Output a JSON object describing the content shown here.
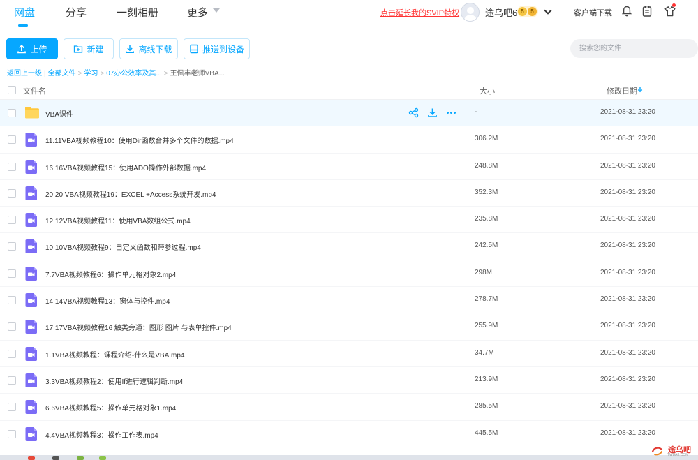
{
  "nav": {
    "tabs": [
      {
        "label": "网盘",
        "active": true
      },
      {
        "label": "分享",
        "active": false
      },
      {
        "label": "一刻相册",
        "active": false
      },
      {
        "label": "更多",
        "active": false
      }
    ],
    "svip_promo": "点击延长我的SVIP特权",
    "username": "途乌吧6",
    "badges": [
      "5",
      "5"
    ],
    "client_download": "客户端下载",
    "icons": [
      "bell-icon",
      "clipboard-icon",
      "shirt-icon"
    ]
  },
  "toolbar": {
    "upload": "上传",
    "new": "新建",
    "offline_download": "离线下载",
    "push_to_device": "推送到设备",
    "search_placeholder": "搜索您的文件"
  },
  "breadcrumb": {
    "back": "返回上一级",
    "all_files": "全部文件",
    "level1": "学习",
    "level2": "07办公效率及其...",
    "current": "王佩丰老师VBA..."
  },
  "table": {
    "headers": {
      "name": "文件名",
      "size": "大小",
      "modified": "修改日期"
    },
    "sort": "modified-desc",
    "rows": [
      {
        "type": "folder",
        "name": "VBA课件",
        "size": "-",
        "date": "2021-08-31 23:20"
      },
      {
        "type": "video",
        "name": "11.11VBA视频教程10：使用Dir函数合并多个文件的数据.mp4",
        "size": "306.2M",
        "date": "2021-08-31 23:20"
      },
      {
        "type": "video",
        "name": "16.16VBA视频教程15：使用ADO操作外部数据.mp4",
        "size": "248.8M",
        "date": "2021-08-31 23:20"
      },
      {
        "type": "video",
        "name": "20.20 VBA视频教程19：EXCEL +Access系统开发.mp4",
        "size": "352.3M",
        "date": "2021-08-31 23:20"
      },
      {
        "type": "video",
        "name": "12.12VBA视频教程11：使用VBA数组公式.mp4",
        "size": "235.8M",
        "date": "2021-08-31 23:20"
      },
      {
        "type": "video",
        "name": "10.10VBA视频教程9：自定义函数和带参过程.mp4",
        "size": "242.5M",
        "date": "2021-08-31 23:20"
      },
      {
        "type": "video",
        "name": "7.7VBA视频教程6：操作单元格对象2.mp4",
        "size": "298M",
        "date": "2021-08-31 23:20"
      },
      {
        "type": "video",
        "name": "14.14VBA视频教程13：窗体与控件.mp4",
        "size": "278.7M",
        "date": "2021-08-31 23:20"
      },
      {
        "type": "video",
        "name": "17.17VBA视频教程16 触类旁通：图形 图片 与表单控件.mp4",
        "size": "255.9M",
        "date": "2021-08-31 23:20"
      },
      {
        "type": "video",
        "name": "1.1VBA视频教程：课程介绍-什么是VBA.mp4",
        "size": "34.7M",
        "date": "2021-08-31 23:20"
      },
      {
        "type": "video",
        "name": "3.3VBA视频教程2：使用If进行逻辑判断.mp4",
        "size": "213.9M",
        "date": "2021-08-31 23:20"
      },
      {
        "type": "video",
        "name": "6.6VBA视频教程5：操作单元格对象1.mp4",
        "size": "285.5M",
        "date": "2021-08-31 23:20"
      },
      {
        "type": "video",
        "name": "4.4VBA视频教程3：操作工作表.mp4",
        "size": "445.5M",
        "date": "2021-08-31 23:20"
      }
    ]
  },
  "watermark": {
    "text": "途乌吧",
    "sub": "TWBA8.COM"
  },
  "colors": {
    "accent": "#06a7ff",
    "promo": "#ff3333",
    "folder": "#ffc83d",
    "video": "#7b6cf6"
  }
}
